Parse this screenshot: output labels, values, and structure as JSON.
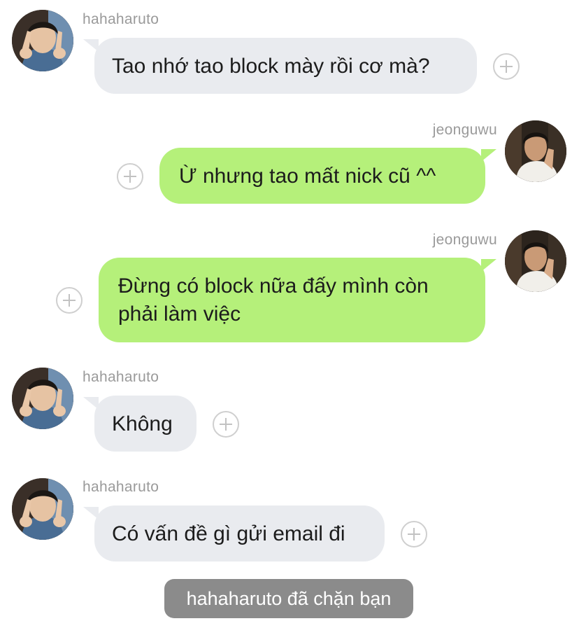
{
  "chat": {
    "messages": [
      {
        "sender": "hahaharuto",
        "direction": "incoming",
        "text": "Tao nhớ tao block mày rồi cơ mà?"
      },
      {
        "sender": "jeonguwu",
        "direction": "outgoing",
        "text": "Ừ nhưng tao mất nick cũ ^^"
      },
      {
        "sender": "jeonguwu",
        "direction": "outgoing",
        "text": "Đừng có block nữa đấy mình còn phải làm việc"
      },
      {
        "sender": "hahaharuto",
        "direction": "incoming",
        "text": "Không"
      },
      {
        "sender": "hahaharuto",
        "direction": "incoming",
        "text": "Có vấn đề gì gửi email đi"
      }
    ],
    "system_notice": "hahaharuto đã chặn bạn"
  },
  "icons": {
    "reaction": "plus-circle-icon",
    "avatar_incoming": "avatar-photo-hahaharuto",
    "avatar_outgoing": "avatar-photo-jeonguwu"
  },
  "colors": {
    "incoming_bubble": "#e9ebef",
    "outgoing_bubble": "#b5f07a",
    "system_notice_bg": "#8b8b8b",
    "sender_name": "#9a9a9a"
  }
}
